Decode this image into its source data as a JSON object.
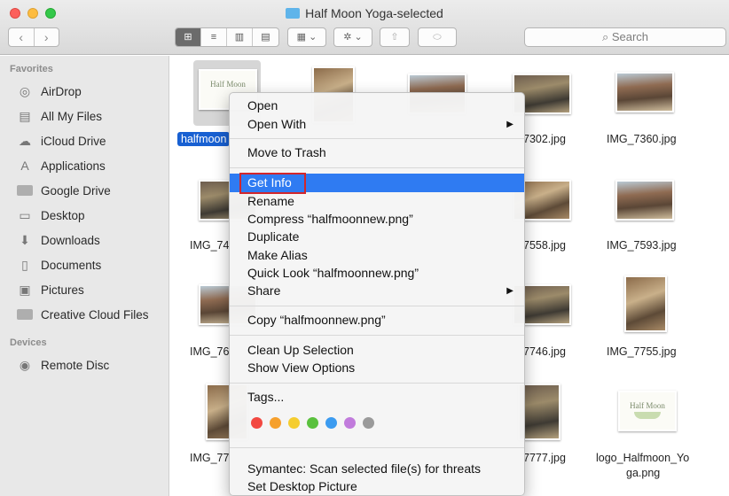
{
  "window": {
    "title": "Half Moon Yoga-selected"
  },
  "toolbar": {
    "back": "‹",
    "forward": "›",
    "views": [
      "⊞",
      "≡",
      "▥",
      "▤"
    ],
    "group": "▦ ⌄",
    "action": "✲ ⌄",
    "share": "⇧",
    "tag": "⬭",
    "search_placeholder": "Search"
  },
  "sidebar": {
    "favorites_header": "Favorites",
    "favorites": [
      {
        "label": "AirDrop",
        "icon": "airdrop-icon"
      },
      {
        "label": "All My Files",
        "icon": "all-files-icon"
      },
      {
        "label": "iCloud Drive",
        "icon": "cloud-icon"
      },
      {
        "label": "Applications",
        "icon": "applications-icon"
      },
      {
        "label": "Google Drive",
        "icon": "folder-icon"
      },
      {
        "label": "Desktop",
        "icon": "desktop-icon"
      },
      {
        "label": "Downloads",
        "icon": "downloads-icon"
      },
      {
        "label": "Documents",
        "icon": "documents-icon"
      },
      {
        "label": "Pictures",
        "icon": "pictures-icon"
      },
      {
        "label": "Creative Cloud Files",
        "icon": "folder-icon"
      }
    ],
    "devices_header": "Devices",
    "devices": [
      {
        "label": "Remote Disc",
        "icon": "disc-icon"
      }
    ]
  },
  "files": {
    "selected": "halfmoon",
    "logo_thumb_text": "Half Moon",
    "row1": [
      "7302.jpg",
      "IMG_7360.jpg"
    ],
    "row2": [
      "IMG_74",
      "7558.jpg",
      "IMG_7593.jpg"
    ],
    "row3": [
      "IMG_76",
      "7746.jpg",
      "IMG_7755.jpg"
    ],
    "row4": [
      "IMG_77",
      "7777.jpg",
      "logo_Halfmoon_Yo",
      "ga.png"
    ]
  },
  "context_menu": {
    "open": "Open",
    "open_with": "Open With",
    "move_to_trash": "Move to Trash",
    "get_info": "Get Info",
    "rename": "Rename",
    "compress": "Compress “halfmoonnew.png”",
    "duplicate": "Duplicate",
    "make_alias": "Make Alias",
    "quick_look": "Quick Look “halfmoonnew.png”",
    "share": "Share",
    "copy": "Copy “halfmoonnew.png”",
    "clean_up": "Clean Up Selection",
    "show_view_options": "Show View Options",
    "tags": "Tags...",
    "tag_colors": [
      "#f24841",
      "#f6a02c",
      "#f5cd2f",
      "#5ac13e",
      "#3b9bf0",
      "#c17bdc",
      "#9a9a9a"
    ],
    "symantec": "Symantec: Scan selected file(s) for threats",
    "set_desktop": "Set Desktop Picture",
    "submenu_arrow": "▶"
  }
}
